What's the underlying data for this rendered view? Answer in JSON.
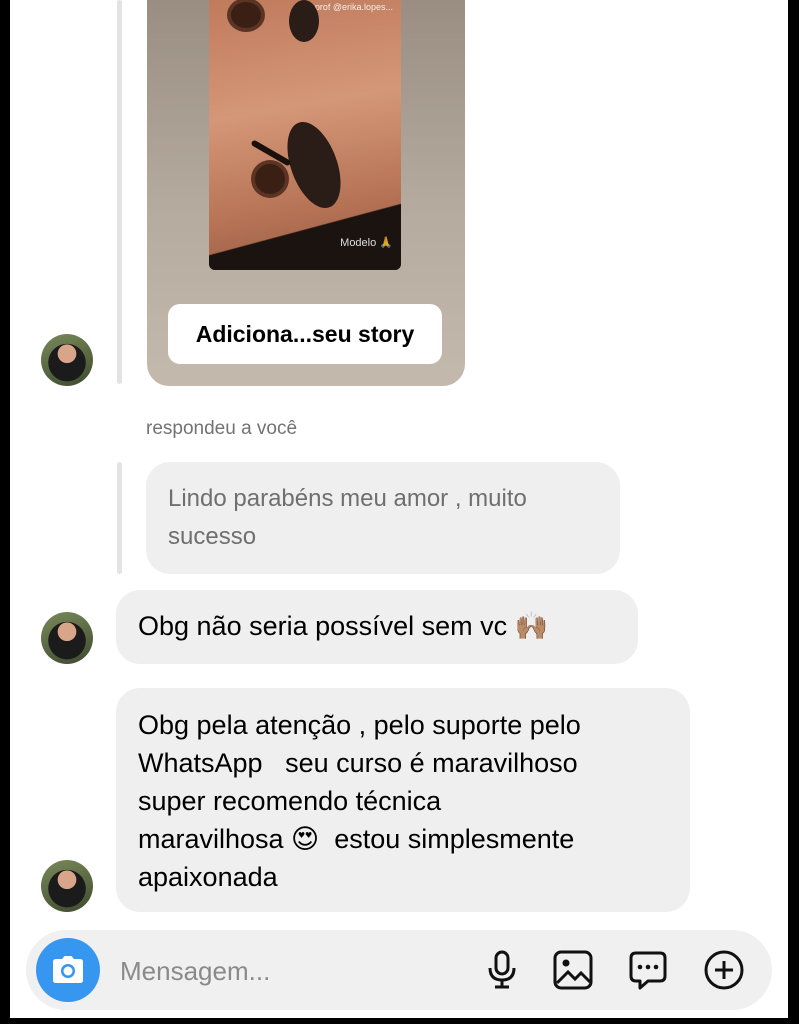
{
  "story": {
    "caption": "Adiciona...seu story",
    "watermark_top": "prof @erika.lopes...",
    "watermark_label": "Modelo 🙏"
  },
  "reply": {
    "label": "respondeu a você",
    "quoted_text": "Lindo parabéns meu amor , muito\nsucesso"
  },
  "messages": [
    {
      "text": "Obg não seria possível sem vc 🙌🏽"
    },
    {
      "text": "Obg pela atenção , pelo suporte pelo\nWhatsApp   seu curso é maravilhoso\nsuper recomendo técnica\nmaravilhosa 😍  estou simplesmente\napaixonada"
    }
  ],
  "composer": {
    "placeholder": "Mensagem...",
    "icons": [
      "camera-icon",
      "microphone-icon",
      "gallery-icon",
      "sticker-icon",
      "add-icon"
    ],
    "accent_color": "#3797f0"
  }
}
